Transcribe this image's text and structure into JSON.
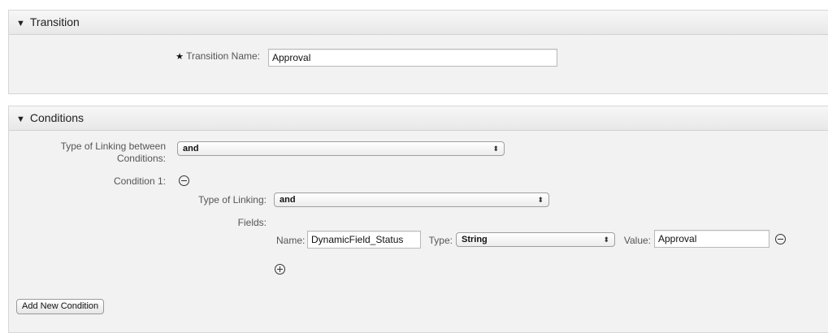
{
  "transition": {
    "header": "Transition",
    "name_label": "Transition Name:",
    "required_marker": "★",
    "name_value": "Approval"
  },
  "conditions": {
    "header": "Conditions",
    "linking_between_label_line1": "Type of Linking between",
    "linking_between_label_line2": "Conditions:",
    "linking_between_value": "and",
    "condition1_label": "Condition 1:",
    "type_of_linking_label": "Type of Linking:",
    "type_of_linking_value": "and",
    "fields_label": "Fields:",
    "field": {
      "name_label": "Name:",
      "name_value": "DynamicField_Status",
      "type_label": "Type:",
      "type_value": "String",
      "value_label": "Value:",
      "value_value": "Approval"
    },
    "add_button": "Add New Condition"
  },
  "icons": {
    "collapse": "triangle-down-icon",
    "remove": "minus-circle-icon",
    "add": "plus-circle-icon",
    "select": "up-down-arrows-icon"
  }
}
